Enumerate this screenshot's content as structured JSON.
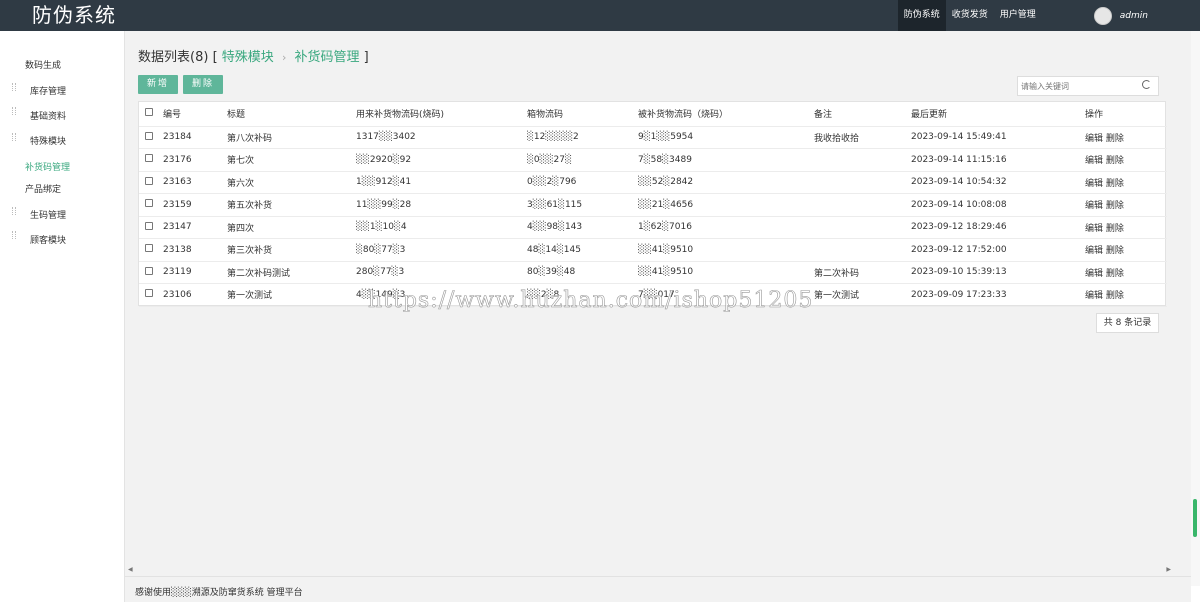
{
  "app": {
    "title": "防伪系统"
  },
  "topnav": {
    "items": [
      {
        "label": "防伪系统"
      },
      {
        "label": "收货发货"
      },
      {
        "label": "用户管理"
      }
    ],
    "user": "admin"
  },
  "sidebar": {
    "items": [
      {
        "label": "数码生成"
      },
      {
        "label": "库存管理"
      },
      {
        "label": "基础资料"
      },
      {
        "label": "特殊模块"
      },
      {
        "label": "补货码管理"
      },
      {
        "label": "产品绑定"
      },
      {
        "label": "生码管理"
      },
      {
        "label": "顾客模块"
      }
    ]
  },
  "main": {
    "heading": {
      "prefix": "数据列表(8)",
      "open": "[",
      "crumb1": "特殊模块",
      "sep": "›",
      "crumb2": "补货码管理",
      "close": "]"
    },
    "buttons": {
      "add": "新增",
      "delete": "删除"
    },
    "search": {
      "placeholder": "请输入关键词"
    },
    "table": {
      "columns": [
        "编号",
        "标题",
        "用来补货物流码(烧码)",
        "箱物流码",
        "被补货物流码（烧码）",
        "备注",
        "最后更新",
        "操作"
      ],
      "rows": [
        {
          "id": "23184",
          "title": "第八次补码",
          "code1": "1317░░3402",
          "code2": "░12░░░░2",
          "code3": "9░1░░5954",
          "note": "我收拾收拾",
          "updated": "2023-09-14 15:49:41"
        },
        {
          "id": "23176",
          "title": "第七次",
          "code1": "░░2920░92",
          "code2": "░0░░27░",
          "code3": "7░58░3489",
          "note": "",
          "updated": "2023-09-14 11:15:16"
        },
        {
          "id": "23163",
          "title": "第六次",
          "code1": "1░░912░41",
          "code2": "0░░2░796",
          "code3": "░░52░2842",
          "note": "",
          "updated": "2023-09-14 10:54:32"
        },
        {
          "id": "23159",
          "title": "第五次补货",
          "code1": "11░░99░28",
          "code2": "3░░61░115",
          "code3": "░░21░4656",
          "note": "",
          "updated": "2023-09-14 10:08:08"
        },
        {
          "id": "23147",
          "title": "第四次",
          "code1": "░░1░10░4",
          "code2": "4░░98░143",
          "code3": "1░62░7016",
          "note": "",
          "updated": "2023-09-12 18:29:46"
        },
        {
          "id": "23138",
          "title": "第三次补货",
          "code1": "░80░77░3",
          "code2": "48░14░145",
          "code3": "░░41░9510",
          "note": "",
          "updated": "2023-09-12 17:52:00"
        },
        {
          "id": "23119",
          "title": "第二次补码测试",
          "code1": "280░77░3",
          "code2": "80░39░48",
          "code3": "░░41░9510",
          "note": "第二次补码",
          "updated": "2023-09-10 15:39:13"
        },
        {
          "id": "23106",
          "title": "第一次测试",
          "code1": "4░░149░3",
          "code2": "░░2░8",
          "code3": "7░░017",
          "note": "第一次测试",
          "updated": "2023-09-09 17:23:33"
        }
      ],
      "actions": {
        "edit": "编辑",
        "delete": "删除"
      }
    },
    "pager": "共 8 条记录"
  },
  "watermark": "https://www.huzhan.com/ishop51205",
  "footer": "感谢使用░░░溯源及防窜货系统 管理平台",
  "colors": {
    "topbar": "#2f3a44",
    "accent": "#5fb69a",
    "link": "#3aa87f"
  }
}
